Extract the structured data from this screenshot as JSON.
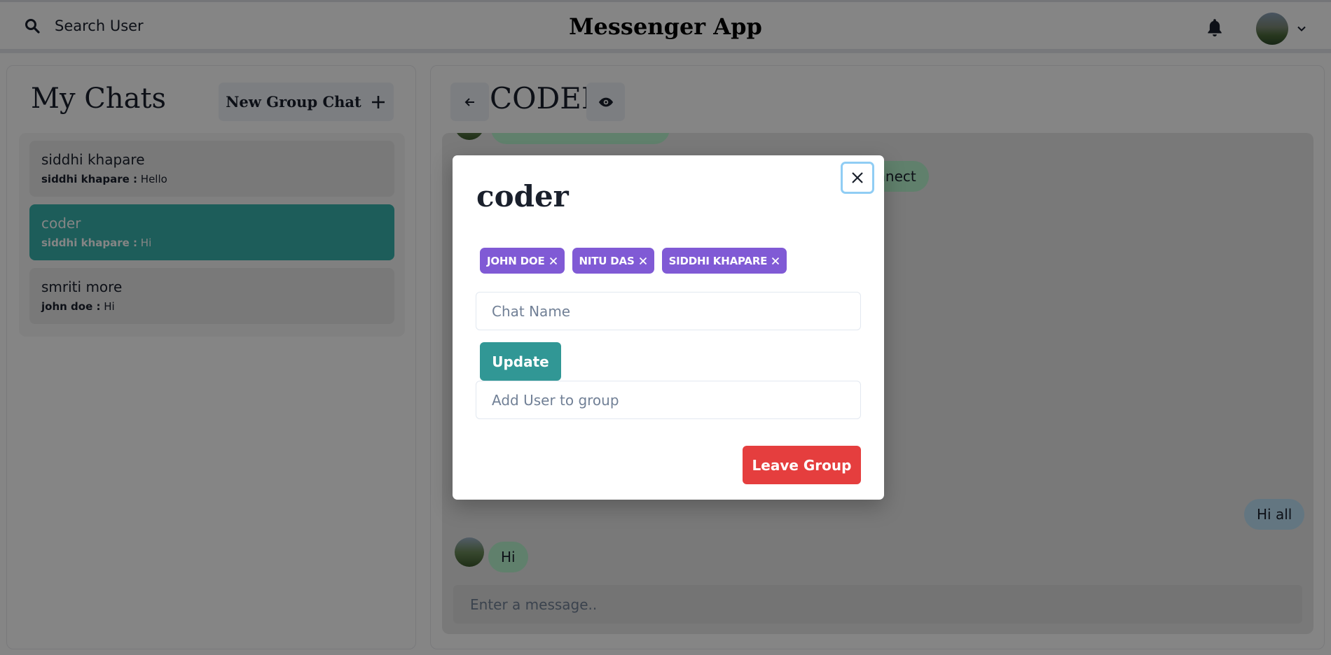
{
  "header": {
    "search_label": "Search User",
    "app_title": "Messenger App"
  },
  "sidebar": {
    "title": "My Chats",
    "new_group_label": "New Group Chat",
    "chats": [
      {
        "name": "siddhi khapare",
        "last_sender": "siddhi khapare :",
        "last_message": "Hello"
      },
      {
        "name": "coder",
        "last_sender": "siddhi khapare :",
        "last_message": "Hi"
      },
      {
        "name": "smriti more",
        "last_sender": "john doe :",
        "last_message": "Hi"
      }
    ]
  },
  "chat": {
    "title": "CODER",
    "messages": [
      {
        "text": "onnect",
        "side": "left"
      },
      {
        "text": "Hi all",
        "side": "right"
      },
      {
        "text": "Hi",
        "side": "left"
      }
    ],
    "input_placeholder": "Enter a message.."
  },
  "modal": {
    "title": "coder",
    "members": [
      "JOHN DOE",
      "NITU DAS",
      "SIDDHI KHAPARE"
    ],
    "chat_name_placeholder": "Chat Name",
    "update_label": "Update",
    "add_user_placeholder": "Add User to group",
    "leave_label": "Leave Group"
  },
  "icons": {
    "search": "search-icon",
    "bell": "bell-icon",
    "chevron": "chevron-down-icon",
    "plus": "plus-icon",
    "back": "arrow-left-icon",
    "eye": "eye-icon",
    "close": "close-icon"
  },
  "colors": {
    "active_chat": "#38b2ac",
    "update_button": "#319795",
    "leave_button": "#e53e3e",
    "member_tag": "#805ad5",
    "bubble_green": "#b9f5d0",
    "bubble_blue": "#bee3f8"
  }
}
